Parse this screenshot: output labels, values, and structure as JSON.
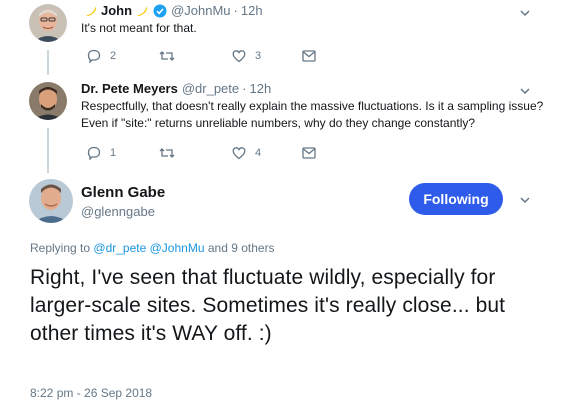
{
  "tweets": [
    {
      "name": "John",
      "handle": "@JohnMu",
      "dot": "·",
      "time": "12h",
      "text": "It's not meant for that.",
      "actions": {
        "replies": "2",
        "retweets": "",
        "likes": "3"
      }
    },
    {
      "name": "Dr. Pete Meyers",
      "handle": "@dr_pete",
      "dot": "·",
      "time": "12h",
      "text": "Respectfully, that doesn't really explain the massive fluctuations. Is it a sampling issue? Even if \"site:\" returns unreliable numbers, why do they change constantly?",
      "actions": {
        "replies": "1",
        "retweets": "",
        "likes": "4"
      }
    }
  ],
  "main_tweet": {
    "name": "Glenn Gabe",
    "handle": "@glenngabe",
    "follow_label": "Following",
    "replying_prefix": "Replying to",
    "replying_user1": "@dr_pete",
    "replying_user2": "@JohnMu",
    "replying_suffix": "and 9 others",
    "text": "Right, I've seen that fluctuate wildly, especially for larger-scale sites. Sometimes it's really close... but other times it's WAY off. :)",
    "timestamp": "8:22 pm - 26 Sep 2018"
  },
  "icons": [
    "reply-icon",
    "retweet-icon",
    "like-icon",
    "message-icon",
    "chevron-down-icon",
    "verified-icon",
    "banana-emoji-icon"
  ],
  "colors": {
    "accent": "#1b95e0",
    "follow_button": "#2f5bea",
    "muted": "#657786",
    "thread_line": "#ccd6dd"
  }
}
